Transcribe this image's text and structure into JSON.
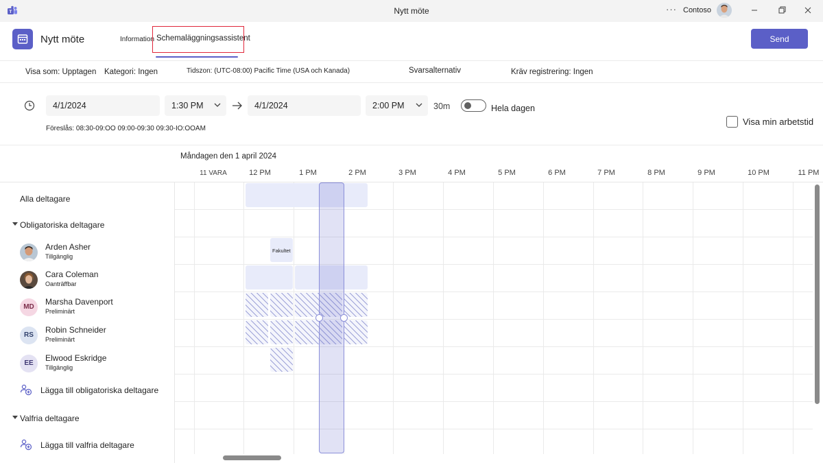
{
  "window": {
    "title": "Nytt möte",
    "more_label": "···",
    "org": "Contoso"
  },
  "header": {
    "title": "Nytt möte",
    "tabs": [
      {
        "label": "Information",
        "active": false
      },
      {
        "label": "Schemaläggningsassistent",
        "active": true
      }
    ],
    "send_label": "Send"
  },
  "options": {
    "show_as": "Visa som: Upptagen",
    "category": "Kategori: Ingen",
    "timezone": "Tidszon: (UTC-08:00) Pacific Time (USA och Kanada)",
    "response": "Svarsalternativ",
    "registration": "Kräv registrering: Ingen"
  },
  "datetime": {
    "start_date": "4/1/2024",
    "start_time": "1:30 PM",
    "end_date": "4/1/2024",
    "end_time": "2:00 PM",
    "duration": "30m",
    "all_day_label": "Hela dagen",
    "all_day": false,
    "suggestions": "Föreslås: 08:30-09:OO 09:00-09:30 09:30-IO:OOAM",
    "show_worktime_label": "Visa min arbetstid",
    "show_worktime": false
  },
  "grid": {
    "day_label": "Måndagen den 1 april 2024",
    "hours": [
      "11 VARA",
      "12 PM",
      "1 PM",
      "2 PM",
      "3 PM",
      "4 PM",
      "5 PM",
      "6 PM",
      "7 PM",
      "8 PM",
      "9 PM",
      "10 PM",
      "11 PM"
    ],
    "event_label": "Fakultet"
  },
  "attendees": {
    "all_label": "Alla deltagare",
    "required_label": "Obligatoriska deltagare",
    "optional_label": "Valfria deltagare",
    "add_required_label": "Lägga till obligatoriska deltagare",
    "add_optional_label": "Lägga till valfria deltagare",
    "people": [
      {
        "name": "Arden Asher",
        "status": "Tillgänglig",
        "avatar": "photo"
      },
      {
        "name": "Cara Coleman",
        "status": "Oanträffbar",
        "avatar": "photo"
      },
      {
        "name": "Marsha Davenport",
        "status": "Preliminärt",
        "initials": "MD",
        "color": "#f5d7e3",
        "text_color": "#7a2d4a"
      },
      {
        "name": "Robin Schneider",
        "status": "Preliminärt",
        "initials": "RS",
        "color": "#dce4f2",
        "text_color": "#2f3f6b"
      },
      {
        "name": "Elwood Eskridge",
        "status": "Tillgänglig",
        "initials": "EE",
        "color": "#e4e2f3",
        "text_color": "#403a75"
      }
    ]
  },
  "colors": {
    "accent": "#5b5fc7",
    "highlight_border": "#e0263a",
    "busy": "#e8ebfa",
    "tentative_stripe": "#9ea3d8"
  }
}
